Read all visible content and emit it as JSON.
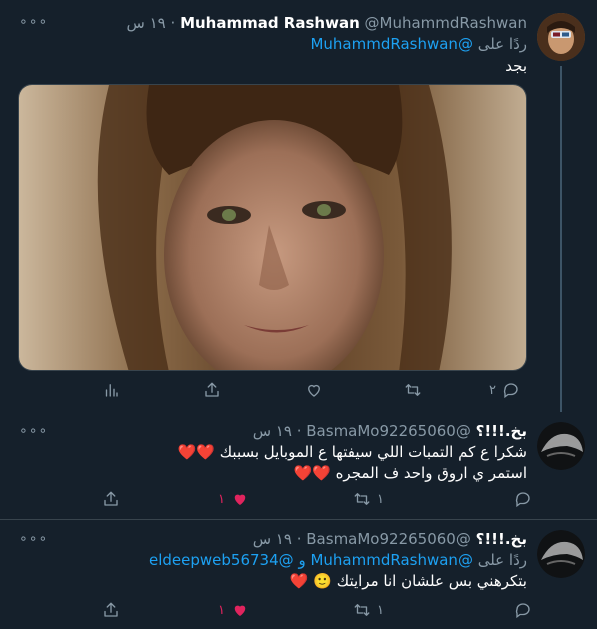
{
  "tweet1": {
    "display_name": "Muhammad Rashwan",
    "handle": "@MuhammdRashwan",
    "separator": "·",
    "time": "١٩ س",
    "reply_prefix": "ردًا على",
    "reply_to": "@MuhammdRashwan",
    "text": "بجد",
    "actions": {
      "reply_count": "٢",
      "retweet_count": "",
      "like_count": ""
    }
  },
  "tweet2": {
    "display_name": "بخ.!!!؟",
    "handle": "@BasmaMo92265060",
    "separator": "·",
    "time": "١٩ س",
    "line1": "شكرا ع كم التمبات اللي سيفتها ع الموبايل بسببك",
    "line2": "استمر ي اروق واحد ف المجره",
    "actions": {
      "reply_count": "",
      "retweet_count": "١",
      "like_count": "١"
    }
  },
  "tweet3": {
    "display_name": "بخ.!!!؟",
    "handle": "@BasmaMo92265060",
    "separator": "·",
    "time": "١٩ س",
    "reply_prefix": "ردًا على",
    "reply_to_1": "@MuhammdRashwan",
    "reply_conj": "و",
    "reply_to_2": "@eldeepweb56734",
    "text": "بتكرهني بس علشان انا مرايتك",
    "actions": {
      "reply_count": "",
      "retweet_count": "١",
      "like_count": "١"
    }
  },
  "more_icon": "ellipsis-icon",
  "colors": {
    "background": "#15202b",
    "accent": "#1da1f2",
    "like": "#e0245e",
    "muted": "#8899a6"
  }
}
